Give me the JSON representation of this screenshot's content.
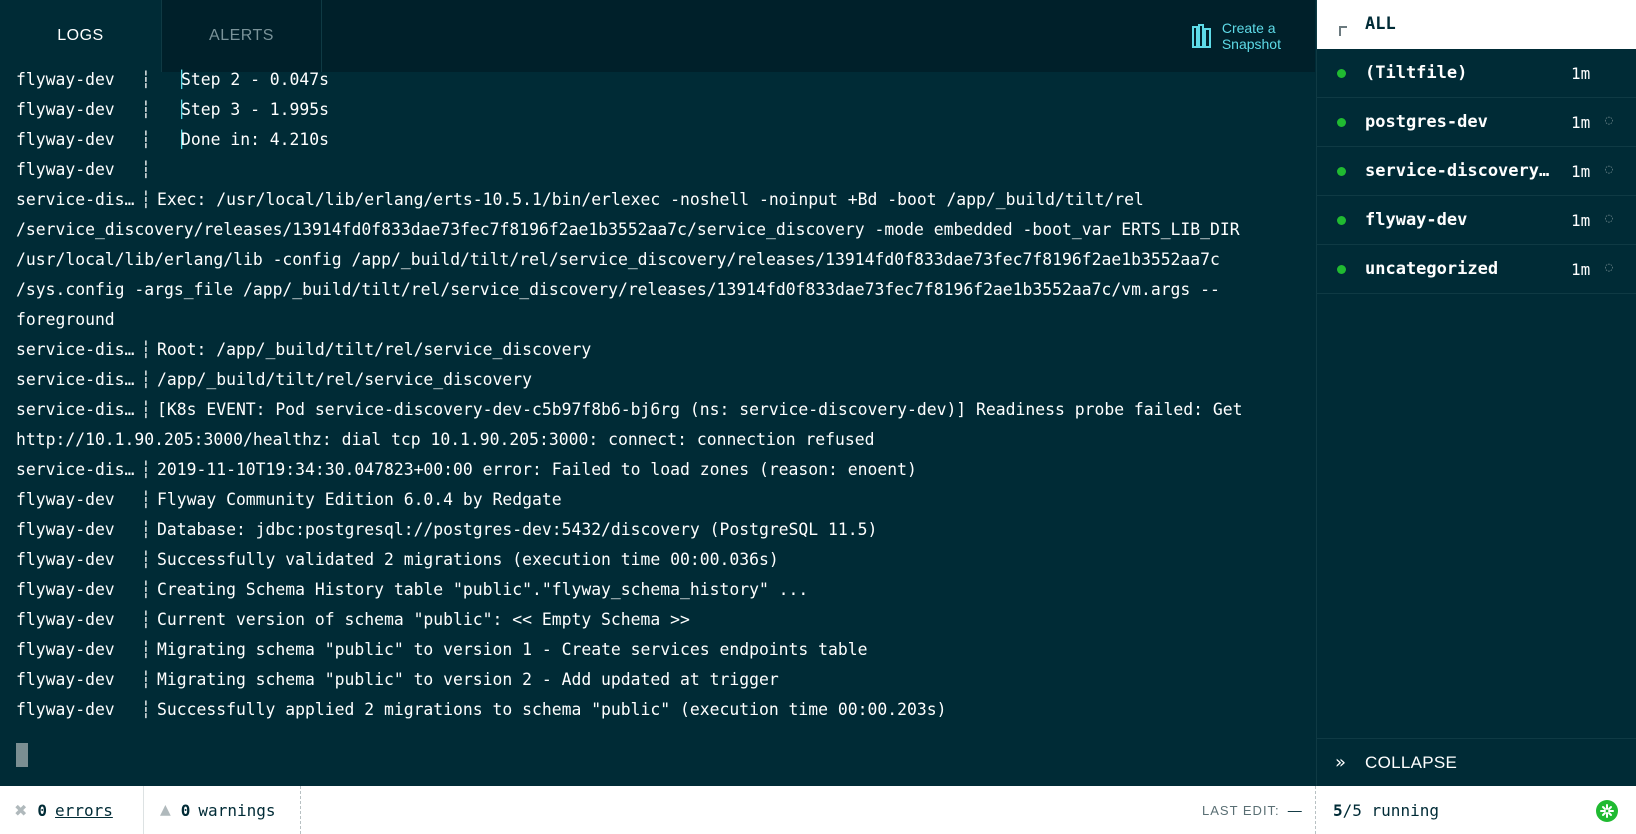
{
  "tabs": {
    "logs": "LOGS",
    "alerts": "ALERTS"
  },
  "snapshot": {
    "line1": "Create a",
    "line2": "Snapshot"
  },
  "logs": [
    {
      "src": "flyway-dev",
      "bar": true,
      "text": "Step 2 - 0.047s"
    },
    {
      "src": "flyway-dev",
      "bar": true,
      "text": "Step 3 - 1.995s"
    },
    {
      "src": "flyway-dev",
      "bar": true,
      "text": "Done in: 4.210s"
    },
    {
      "src": "flyway-dev",
      "bar": false,
      "text": ""
    },
    {
      "src": "service-discovery-dev",
      "bar": false,
      "text": "Exec: /usr/local/lib/erlang/erts-10.5.1/bin/erlexec -noshell -noinput +Bd -boot /app/_build/tilt/rel"
    },
    {
      "cont": true,
      "text": "/service_discovery/releases/13914fd0f833dae73fec7f8196f2ae1b3552aa7c/service_discovery -mode embedded -boot_var ERTS_LIB_DIR"
    },
    {
      "cont": true,
      "text": "/usr/local/lib/erlang/lib -config /app/_build/tilt/rel/service_discovery/releases/13914fd0f833dae73fec7f8196f2ae1b3552aa7c"
    },
    {
      "cont": true,
      "text": "/sys.config -args_file /app/_build/tilt/rel/service_discovery/releases/13914fd0f833dae73fec7f8196f2ae1b3552aa7c/vm.args --"
    },
    {
      "cont": true,
      "text": "foreground"
    },
    {
      "src": "service-discovery-dev",
      "bar": false,
      "text": "Root: /app/_build/tilt/rel/service_discovery"
    },
    {
      "src": "service-discovery-dev",
      "bar": false,
      "text": "/app/_build/tilt/rel/service_discovery"
    },
    {
      "src": "service-discovery-dev",
      "bar": false,
      "text": "[K8s EVENT: Pod service-discovery-dev-c5b97f8b6-bj6rg (ns: service-discovery-dev)] Readiness probe failed: Get"
    },
    {
      "cont": true,
      "text": "http://10.1.90.205:3000/healthz: dial tcp 10.1.90.205:3000: connect: connection refused"
    },
    {
      "src": "service-discovery-dev",
      "bar": false,
      "text": "2019-11-10T19:34:30.047823+00:00 error: Failed to load zones (reason: enoent)"
    },
    {
      "src": "flyway-dev",
      "bar": false,
      "text": "Flyway Community Edition 6.0.4 by Redgate"
    },
    {
      "src": "flyway-dev",
      "bar": false,
      "text": "Database: jdbc:postgresql://postgres-dev:5432/discovery (PostgreSQL 11.5)"
    },
    {
      "src": "flyway-dev",
      "bar": false,
      "text": "Successfully validated 2 migrations (execution time 00:00.036s)"
    },
    {
      "src": "flyway-dev",
      "bar": false,
      "text": "Creating Schema History table \"public\".\"flyway_schema_history\" ..."
    },
    {
      "src": "flyway-dev",
      "bar": false,
      "text": "Current version of schema \"public\": << Empty Schema >>"
    },
    {
      "src": "flyway-dev",
      "bar": false,
      "text": "Migrating schema \"public\" to version 1 - Create services endpoints table"
    },
    {
      "src": "flyway-dev",
      "bar": false,
      "text": "Migrating schema \"public\" to version 2 - Add updated at trigger"
    },
    {
      "src": "flyway-dev",
      "bar": false,
      "text": "Successfully applied 2 migrations to schema \"public\" (execution time 00:00.203s)"
    }
  ],
  "sidebar": {
    "all_label": "ALL",
    "resources": [
      {
        "name": "(Tiltfile)",
        "time": "1m",
        "spinner": false
      },
      {
        "name": "postgres-dev",
        "time": "1m",
        "spinner": true
      },
      {
        "name": "service-discovery-dev",
        "time": "1m",
        "spinner": true
      },
      {
        "name": "flyway-dev",
        "time": "1m",
        "spinner": true
      },
      {
        "name": "uncategorized",
        "time": "1m",
        "spinner": true
      }
    ],
    "collapse_label": "COLLAPSE"
  },
  "status": {
    "errors_count": "0",
    "errors_label": "errors",
    "warnings_count": "0",
    "warnings_label": "warnings",
    "last_edit_label": "LAST EDIT:",
    "last_edit_value": "—",
    "running_count": "5",
    "running_total": "/5 running"
  },
  "colors": {
    "background": "#002b36",
    "accent": "#5edbe8",
    "ok": "#20ba31"
  }
}
